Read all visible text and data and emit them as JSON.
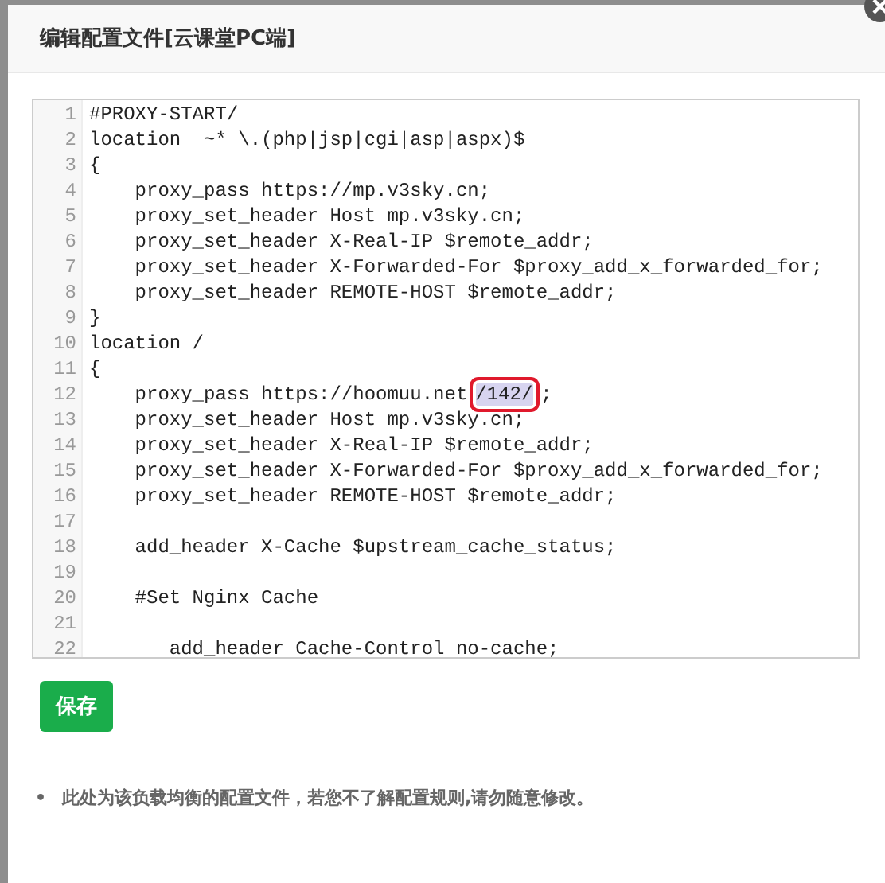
{
  "dialog": {
    "title": "编辑配置文件[云课堂PC端]"
  },
  "editor": {
    "lines": [
      {
        "num": "1",
        "text": "#PROXY-START/"
      },
      {
        "num": "2",
        "text": "location  ~* \\.(php|jsp|cgi|asp|aspx)$"
      },
      {
        "num": "3",
        "text": "{"
      },
      {
        "num": "4",
        "text": "    proxy_pass https://mp.v3sky.cn;"
      },
      {
        "num": "5",
        "text": "    proxy_set_header Host mp.v3sky.cn;"
      },
      {
        "num": "6",
        "text": "    proxy_set_header X-Real-IP $remote_addr;"
      },
      {
        "num": "7",
        "text": "    proxy_set_header X-Forwarded-For $proxy_add_x_forwarded_for;"
      },
      {
        "num": "8",
        "text": "    proxy_set_header REMOTE-HOST $remote_addr;"
      },
      {
        "num": "9",
        "text": "}"
      },
      {
        "num": "10",
        "text": "location /"
      },
      {
        "num": "11",
        "text": "{"
      },
      {
        "num": "12",
        "text": "    proxy_pass https://hoomuu.net",
        "selection": "/142/",
        "rest": ";"
      },
      {
        "num": "13",
        "text": "    proxy_set_header Host mp.v3sky.cn;"
      },
      {
        "num": "14",
        "text": "    proxy_set_header X-Real-IP $remote_addr;"
      },
      {
        "num": "15",
        "text": "    proxy_set_header X-Forwarded-For $proxy_add_x_forwarded_for;"
      },
      {
        "num": "16",
        "text": "    proxy_set_header REMOTE-HOST $remote_addr;"
      },
      {
        "num": "17"
      },
      {
        "num": "18",
        "text": "    add_header X-Cache $upstream_cache_status;"
      },
      {
        "num": "19"
      },
      {
        "num": "20",
        "text": "    #Set Nginx Cache"
      },
      {
        "num": "21"
      },
      {
        "num": "22",
        "text": "       add_header Cache-Control no-cache;"
      }
    ]
  },
  "save_button": "保存",
  "notes": [
    {
      "bullet": "•",
      "text": "此处为该负载均衡的配置文件，若您不了解配置规则,请勿随意修改。"
    }
  ]
}
